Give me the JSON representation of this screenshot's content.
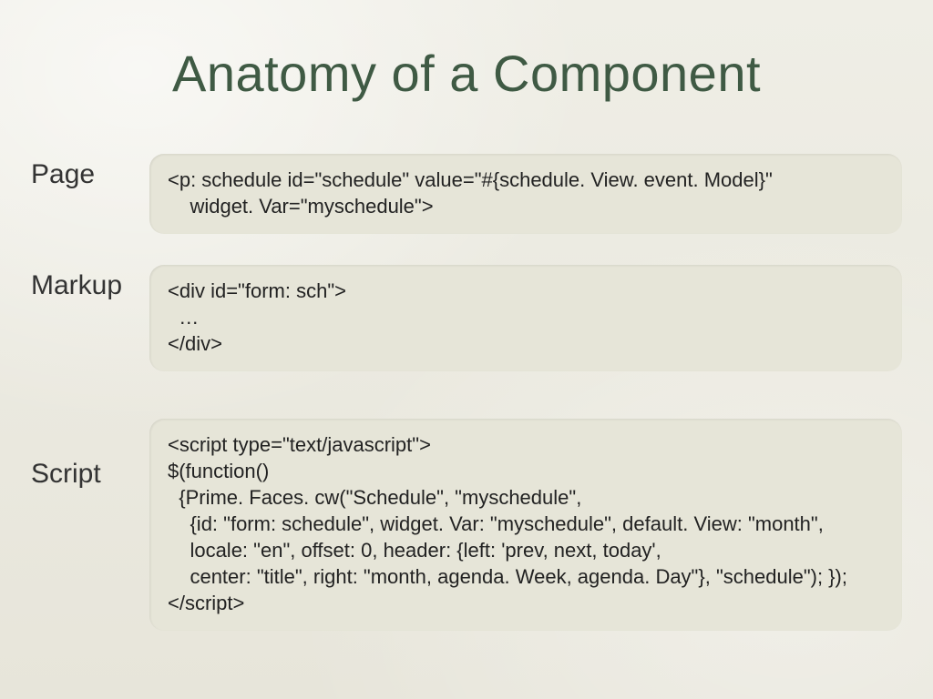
{
  "title": "Anatomy of a Component",
  "sections": [
    {
      "label": "Page",
      "code": "<p: schedule id=\"schedule\" value=\"#{schedule. View. event. Model}\"\n    widget. Var=\"myschedule\">"
    },
    {
      "label": "Markup",
      "code": "<div id=\"form: sch\">\n  …\n</div>"
    },
    {
      "label": "Script",
      "code": "<script type=\"text/javascript\">\n$(function()\n  {Prime. Faces. cw(\"Schedule\", \"myschedule\",\n    {id: \"form: schedule\", widget. Var: \"myschedule\", default. View: \"month\",\n    locale: \"en\", offset: 0, header: {left: 'prev, next, today',\n    center: \"title\", right: \"month, agenda. Week, agenda. Day\"}, \"schedule\"); });\n</script>"
    }
  ]
}
